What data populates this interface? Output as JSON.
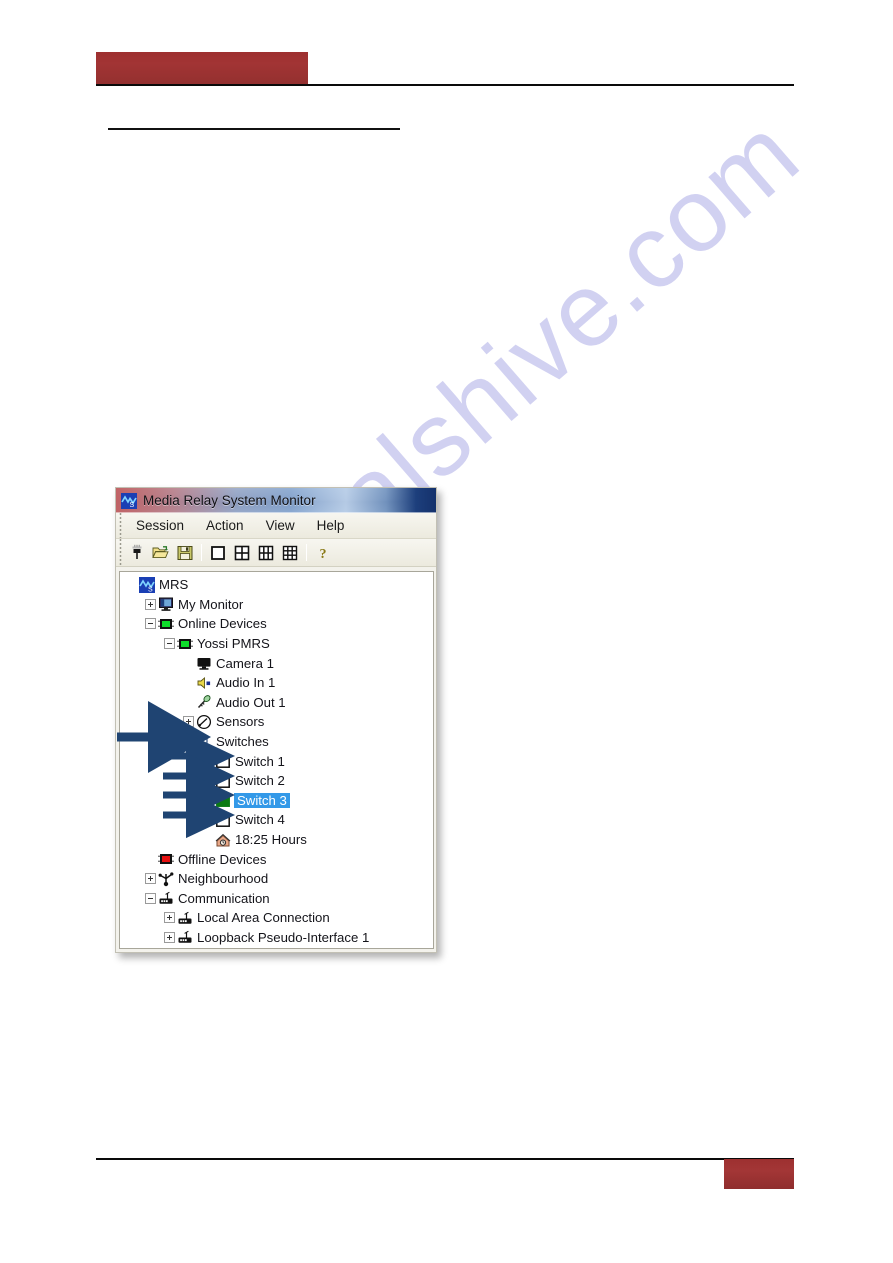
{
  "page": {
    "watermark_text": "manualshive.com",
    "banner_color": "#9d3030",
    "rule_color": "#0a0a0a"
  },
  "window": {
    "title": "Media Relay System Monitor",
    "title_icon": "mrs-logo-icon",
    "menu": [
      {
        "label": "Session"
      },
      {
        "label": "Action"
      },
      {
        "label": "View"
      },
      {
        "label": "Help"
      }
    ],
    "toolbar": [
      {
        "name": "connect-icon",
        "tooltip": "Connect"
      },
      {
        "name": "open-folder-icon",
        "tooltip": "Open"
      },
      {
        "name": "save-icon",
        "tooltip": "Save"
      },
      {
        "name": "layout-1x1-icon",
        "tooltip": "Single view"
      },
      {
        "name": "layout-2x2-icon",
        "tooltip": "2 x 2 view"
      },
      {
        "name": "layout-2x3-icon",
        "tooltip": "2 x 3 view"
      },
      {
        "name": "layout-3x3-icon",
        "tooltip": "3 x 3 view"
      },
      {
        "name": "help-icon",
        "tooltip": "Help"
      }
    ]
  },
  "tree": {
    "nodes": [
      {
        "label": "MRS",
        "icon": "mrs-logo-icon",
        "depth": 0,
        "toggle": "none",
        "selected": false
      },
      {
        "label": "My Monitor",
        "icon": "monitor-icon",
        "depth": 1,
        "toggle": "plus",
        "selected": false
      },
      {
        "label": "Online Devices",
        "icon": "green-device-icon",
        "depth": 1,
        "toggle": "minus",
        "selected": false
      },
      {
        "label": "Yossi PMRS",
        "icon": "green-device-icon",
        "depth": 2,
        "toggle": "minus",
        "selected": false
      },
      {
        "label": "Camera 1",
        "icon": "camera-icon",
        "depth": 3,
        "toggle": "none",
        "selected": false
      },
      {
        "label": "Audio In 1",
        "icon": "audio-in-icon",
        "depth": 3,
        "toggle": "none",
        "selected": false
      },
      {
        "label": "Audio Out 1",
        "icon": "audio-out-icon",
        "depth": 3,
        "toggle": "none",
        "selected": false
      },
      {
        "label": "Sensors",
        "icon": "sensor-gauge-icon",
        "depth": 3,
        "toggle": "plus",
        "selected": false
      },
      {
        "label": "Switches",
        "icon": "switch-lamp-icon",
        "depth": 3,
        "toggle": "minus",
        "selected": false
      },
      {
        "label": "Switch 1",
        "icon": "checkbox-off-icon",
        "depth": 4,
        "toggle": "none",
        "selected": false
      },
      {
        "label": "Switch 2",
        "icon": "checkbox-off-icon",
        "depth": 4,
        "toggle": "none",
        "selected": false
      },
      {
        "label": "Switch 3",
        "icon": "checkbox-on-icon",
        "depth": 4,
        "toggle": "none",
        "selected": true
      },
      {
        "label": "Switch 4",
        "icon": "checkbox-off-icon",
        "depth": 4,
        "toggle": "none",
        "selected": false
      },
      {
        "label": "18:25 Hours",
        "icon": "clock-house-icon",
        "depth": 4,
        "toggle": "none",
        "selected": false
      },
      {
        "label": "Offline Devices",
        "icon": "red-device-icon",
        "depth": 1,
        "toggle": "none",
        "selected": false
      },
      {
        "label": "Neighbourhood",
        "icon": "network-node-icon",
        "depth": 1,
        "toggle": "plus",
        "selected": false
      },
      {
        "label": "Communication",
        "icon": "router-icon",
        "depth": 1,
        "toggle": "minus",
        "selected": false
      },
      {
        "label": "Local Area Connection",
        "icon": "router-icon",
        "depth": 2,
        "toggle": "plus",
        "selected": false
      },
      {
        "label": "Loopback Pseudo-Interface 1",
        "icon": "router-icon",
        "depth": 2,
        "toggle": "plus",
        "selected": false
      }
    ],
    "selection_color": "#3399e8",
    "switch_on_color": "#0a7a14"
  },
  "annotations": {
    "arrow_color": "#1f4472",
    "arrows": [
      {
        "name": "arrow-to-switches",
        "target": "Switches"
      },
      {
        "name": "arrow-to-switch-1",
        "target": "Switch 1"
      },
      {
        "name": "arrow-to-switch-2",
        "target": "Switch 2"
      },
      {
        "name": "arrow-to-switch-3",
        "target": "Switch 3"
      },
      {
        "name": "arrow-to-switch-4",
        "target": "Switch 4"
      }
    ]
  }
}
